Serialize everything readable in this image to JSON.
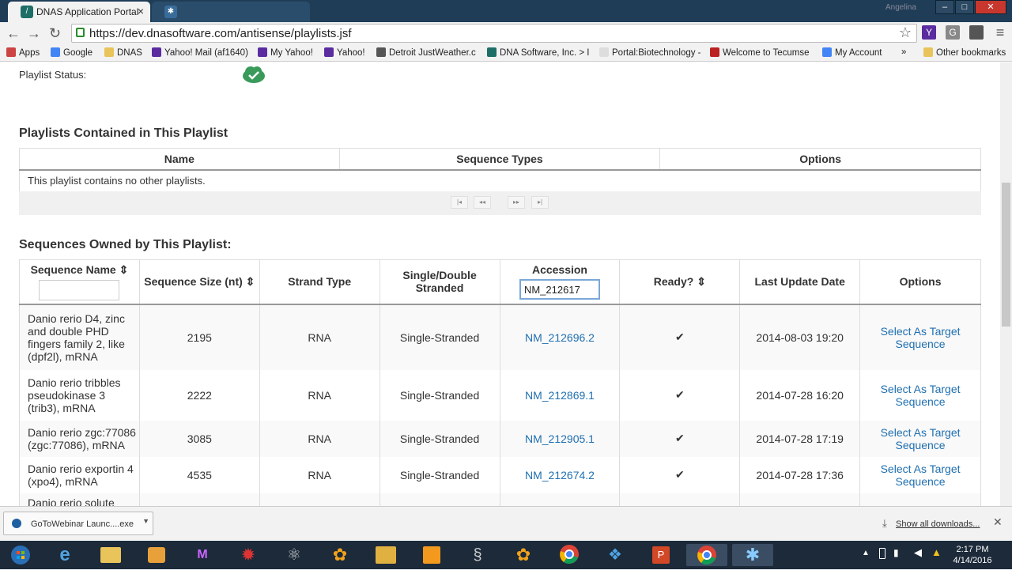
{
  "browser": {
    "tabs": [
      {
        "label": "DNAS Application Portal"
      },
      {
        "label": ""
      }
    ],
    "window_user": "Angelina",
    "url": "https://dev.dnasoftware.com/antisense/playlists.jsf",
    "extension_labels": [
      "Y",
      "G",
      "",
      ""
    ],
    "bookmarks": [
      "Apps",
      "Google",
      "DNAS",
      "Yahoo! Mail (af1640)",
      "My Yahoo!",
      "Yahoo!",
      "Detroit JustWeather.c",
      "DNA Software, Inc. > I",
      "Portal:Biotechnology -",
      "Welcome to Tecumse",
      "My Account"
    ],
    "bookmarks_more": "»",
    "other_bookmarks": "Other bookmarks"
  },
  "page": {
    "playlist_status_label": "Playlist Status:",
    "playlists_section_title": "Playlists Contained in This Playlist",
    "playlists_columns": [
      "Name",
      "Sequence Types",
      "Options"
    ],
    "playlists_empty_message": "This playlist contains no other playlists.",
    "pager_buttons": [
      "|◂",
      "◂◂",
      "▸▸",
      "▸|"
    ],
    "sequences_section_title": "Sequences Owned by This Playlist:",
    "sequences_columns": {
      "name": "Sequence Name ⇕",
      "size": "Sequence Size (nt) ⇕",
      "strand_type": "Strand Type",
      "stranded": "Single/Double Stranded",
      "accession": "Accession",
      "ready": "Ready? ⇕",
      "updated": "Last Update Date",
      "options": "Options"
    },
    "accession_filter_value": "NM_212617",
    "sequences": [
      {
        "name": "Danio rerio D4, zinc and double PHD fingers family 2, like (dpf2l), mRNA",
        "size": "2195",
        "strand_type": "RNA",
        "stranded": "Single-Stranded",
        "accession": "NM_212696.2",
        "ready": "✔",
        "updated": "2014-08-03 19:20",
        "option": "Select As Target Sequence"
      },
      {
        "name": "Danio rerio tribbles pseudokinase 3 (trib3), mRNA",
        "size": "2222",
        "strand_type": "RNA",
        "stranded": "Single-Stranded",
        "accession": "NM_212869.1",
        "ready": "✔",
        "updated": "2014-07-28 16:20",
        "option": "Select As Target Sequence"
      },
      {
        "name": "Danio rerio zgc:77086 (zgc:77086), mRNA",
        "size": "3085",
        "strand_type": "RNA",
        "stranded": "Single-Stranded",
        "accession": "NM_212905.1",
        "ready": "✔",
        "updated": "2014-07-28 17:19",
        "option": "Select As Target Sequence"
      },
      {
        "name": "Danio rerio exportin 4 (xpo4), mRNA",
        "size": "4535",
        "strand_type": "RNA",
        "stranded": "Single-Stranded",
        "accession": "NM_212674.2",
        "ready": "✔",
        "updated": "2014-07-28 17:36",
        "option": "Select As Target Sequence"
      },
      {
        "name": "Danio rerio solute",
        "size": "",
        "strand_type": "",
        "stranded": "",
        "accession": "",
        "ready": "",
        "updated": "",
        "option": ""
      }
    ]
  },
  "downloads": {
    "file": "GoToWebinar Launc....exe",
    "show_all": "Show all downloads..."
  },
  "taskbar": {
    "time": "2:17 PM",
    "date": "4/14/2016"
  }
}
